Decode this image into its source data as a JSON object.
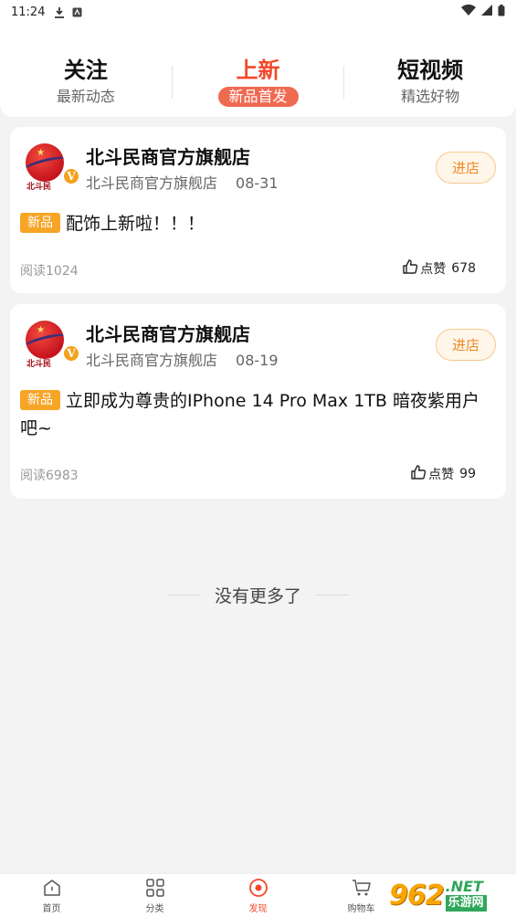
{
  "status_bar": {
    "time": "11:24"
  },
  "top_tabs": [
    {
      "title": "关注",
      "sub": "最新动态",
      "active": false
    },
    {
      "title": "上新",
      "sub": "新品首发",
      "active": true
    },
    {
      "title": "短视频",
      "sub": "精选好物",
      "active": false
    }
  ],
  "posts": [
    {
      "avatar_text": "北斗民",
      "shop_name": "北斗民商官方旗舰店",
      "store_label": "北斗民商官方旗舰店",
      "date": "08-31",
      "enter_label": "进店",
      "badge": "新品",
      "text": "配饰上新啦！！！",
      "read_label": "阅读1024",
      "like_label": "点赞",
      "like_count": "678"
    },
    {
      "avatar_text": "北斗民",
      "shop_name": "北斗民商官方旗舰店",
      "store_label": "北斗民商官方旗舰店",
      "date": "08-19",
      "enter_label": "进店",
      "badge": "新品",
      "text": "立即成为尊贵的IPhone 14 Pro Max 1TB 暗夜紫用户吧~",
      "read_label": "阅读6983",
      "like_label": "点赞",
      "like_count": "99"
    }
  ],
  "no_more_text": "没有更多了",
  "bottom_nav": [
    {
      "label": "首页",
      "icon": "home-icon"
    },
    {
      "label": "分类",
      "icon": "category-icon"
    },
    {
      "label": "发现",
      "icon": "discover-icon",
      "active": true
    },
    {
      "label": "购物车",
      "icon": "cart-icon"
    }
  ],
  "watermark": {
    "number": "962",
    "net": ".NET",
    "cn": "乐游网"
  },
  "colors": {
    "accent": "#f2482a",
    "badge": "#f7a526",
    "enter": "#f08a24"
  }
}
